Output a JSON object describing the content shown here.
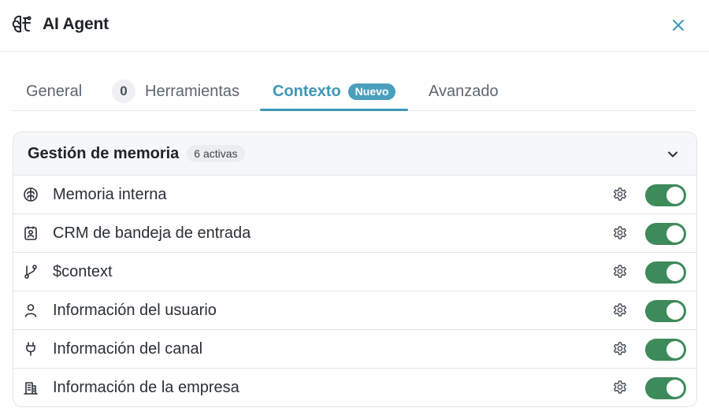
{
  "app": {
    "title": "AI Agent",
    "icon": "brain-circuit-icon"
  },
  "tabs": [
    {
      "label": "General",
      "active": false
    },
    {
      "label": "Herramientas",
      "count": "0",
      "active": false
    },
    {
      "label": "Contexto",
      "badge": "Nuevo",
      "active": true
    },
    {
      "label": "Avanzado",
      "active": false
    }
  ],
  "memory": {
    "title": "Gestión de memoria",
    "active_badge": "6 activas",
    "items": [
      {
        "label": "Memoria interna",
        "icon": "brain-icon",
        "enabled": true
      },
      {
        "label": "CRM de bandeja de entrada",
        "icon": "contact-card-icon",
        "enabled": true
      },
      {
        "label": "$context",
        "icon": "git-branch-icon",
        "enabled": true
      },
      {
        "label": "Información del usuario",
        "icon": "user-icon",
        "enabled": true
      },
      {
        "label": "Información del canal",
        "icon": "plug-icon",
        "enabled": true
      },
      {
        "label": "Información de la empresa",
        "icon": "building-icon",
        "enabled": true
      }
    ]
  },
  "colors": {
    "accent": "#3f96b6",
    "toggle_on": "#3d8a5a"
  }
}
